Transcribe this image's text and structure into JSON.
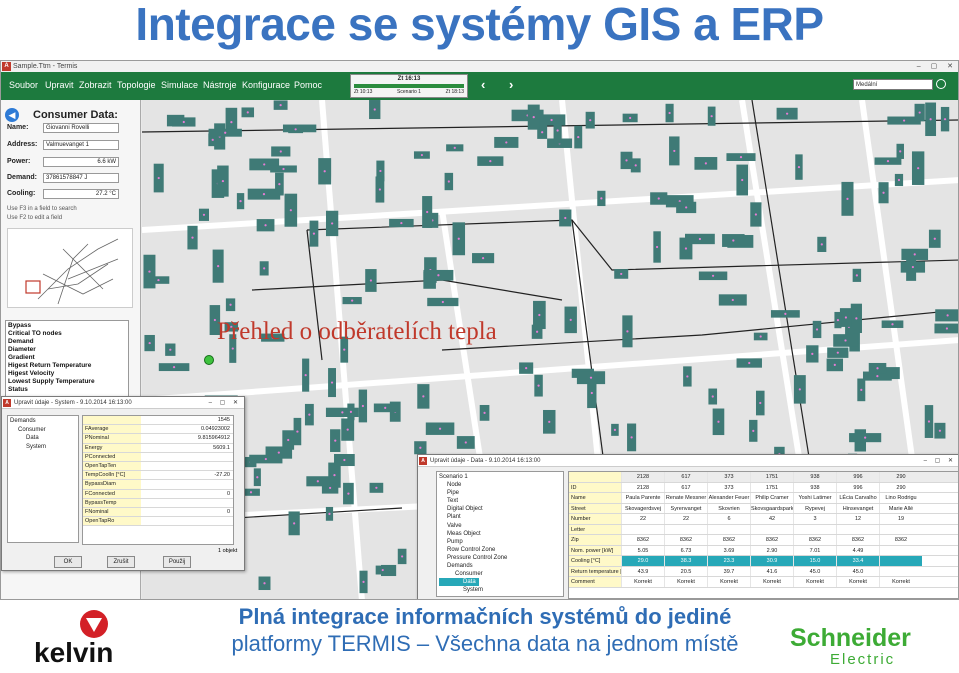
{
  "slide_title": "Integrace se systémy GIS a ERP",
  "app": {
    "window_title": "Sample.Ttm - Termis",
    "menus": [
      "Soubor",
      "Upravit",
      "Zobrazit",
      "Topologie",
      "Simulace",
      "Nástroje",
      "Konfigurace",
      "Pomoc"
    ],
    "time": {
      "label": "Zt 16:13",
      "left": "Zt 10:13",
      "mid": "Scenario 1",
      "right": "Zt 18:13"
    },
    "search_value": "Medální",
    "colors": {
      "menubar": "#1d7a3e",
      "accent": "#27a8b8",
      "title": "#3a73c0",
      "overlay": "#c0392b"
    }
  },
  "consumer": {
    "title": "Consumer Data:",
    "fields": [
      {
        "label": "Name:",
        "value": "Giovanni Rovelli"
      },
      {
        "label": "Address:",
        "value": "Valmuevanget   1"
      },
      {
        "label": "Power:",
        "value": "6.6  kW"
      },
      {
        "label": "Demand:",
        "value": "37861578847 J"
      },
      {
        "label": "Cooling:",
        "value": "27.2  °C"
      }
    ],
    "hints": [
      "Use F3 in a field to search",
      "Use F2 to edit a field"
    ],
    "list": [
      "Bypass",
      "Critical TO nodes",
      "Demand",
      "Diameter",
      "Gradient",
      "Higest Return Temperature",
      "Higest Velocity",
      "Lowest Supply Temperature",
      "Status"
    ]
  },
  "map_overlay": "Přehled o odběratelích tepla",
  "dialog1": {
    "title": "Upravit údaje - System - 9.10.2014 16:13:00",
    "tree": [
      "Demands",
      "Consumer",
      "Data",
      "System"
    ],
    "header_value": "1545",
    "rows": [
      {
        "k": "FAverage",
        "v": "0.04923002"
      },
      {
        "k": "PNominal",
        "v": "9.815964912"
      },
      {
        "k": "Energy",
        "v": "5609.1"
      },
      {
        "k": "PConnected",
        "v": ""
      },
      {
        "k": "OpenTapTen",
        "v": ""
      },
      {
        "k": "TempCoolIn [°C]",
        "v": "-27.20"
      },
      {
        "k": "BypassDiam",
        "v": ""
      },
      {
        "k": "FConnected",
        "v": "0"
      },
      {
        "k": "BypassTemp",
        "v": ""
      },
      {
        "k": "FNominal",
        "v": "0"
      },
      {
        "k": "OpenTapRo",
        "v": ""
      }
    ],
    "count": "1 objekt",
    "buttons": [
      "OK",
      "Zrušit",
      "Použij"
    ]
  },
  "dialog2": {
    "title": "Upravit údaje - Data - 9.10.2014 16:13:00",
    "tree": [
      "Scenario 1",
      "Node",
      "Pipe",
      "Text",
      "Digital Object",
      "Plant",
      "Valve",
      "Meas Object",
      "Pump",
      "Row Control Zone",
      "Pressure Control Zone",
      "Demands",
      "Consumer",
      "Data",
      "System"
    ],
    "header": [
      "",
      "2128",
      "617",
      "373",
      "1751",
      "938",
      "996",
      "290"
    ],
    "rows": [
      {
        "k": "ID",
        "c": [
          "2128",
          "617",
          "373",
          "1751",
          "938",
          "996",
          "290"
        ]
      },
      {
        "k": "Name",
        "c": [
          "Paula Parente",
          "Renate Messner",
          "Alexander Feuer",
          "Philip Cramer",
          "Yoshi Latimer",
          "LÉcia Carvalho",
          "Lino Rodrigu"
        ]
      },
      {
        "k": "Street",
        "c": [
          "Skovagerdsvej",
          "Syrenvanget",
          "Skovrien",
          "Skovsgaardsparken",
          "Rypevej",
          "Hinsevanget",
          "Marie Allé"
        ]
      },
      {
        "k": "Number",
        "c": [
          "22",
          "22",
          "6",
          "42",
          "3",
          "12",
          "19"
        ]
      },
      {
        "k": "Letter",
        "c": [
          "",
          "",
          "",
          "",
          "",
          "",
          ""
        ]
      },
      {
        "k": "Zip",
        "c": [
          "8362",
          "8362",
          "8362",
          "8362",
          "8362",
          "8362",
          "8362"
        ]
      },
      {
        "k": "Nom. power [kW]",
        "c": [
          "5.05",
          "6.73",
          "3.69",
          "2.90",
          "7.01",
          "4.49",
          ""
        ]
      },
      {
        "k": "Cooling [°C]",
        "c": [
          "29.0",
          "38.3",
          "23.3",
          "30.9",
          "15.0",
          "33.4",
          ""
        ]
      },
      {
        "k": "Return temperature [°C]",
        "c": [
          "43.9",
          "20.5",
          "39.7",
          "41.6",
          "45.0",
          "45.0",
          ""
        ]
      },
      {
        "k": "Comment",
        "c": [
          "Korrekt",
          "Korrekt",
          "Korrekt",
          "Korrekt",
          "Korrekt",
          "Korrekt",
          "Korrekt"
        ]
      }
    ]
  },
  "footer": {
    "line1": "Plná integrace informačních systémů do jediné",
    "line2": "platformy TERMIS – Všechna data na jednom místě"
  },
  "logos": {
    "left": "kelvin",
    "right_line1": "Schneider",
    "right_line2": "Electric"
  }
}
